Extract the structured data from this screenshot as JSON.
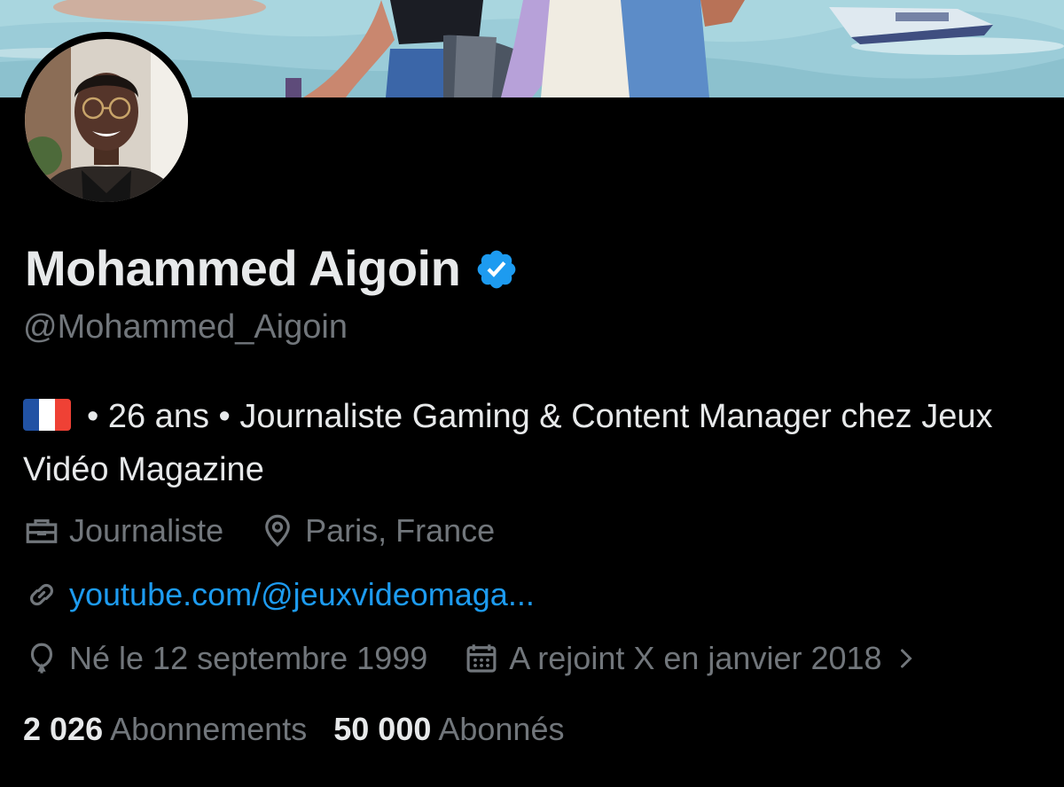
{
  "profile": {
    "display_name": "Mohammed Aigoin",
    "handle": "@Mohammed_Aigoin",
    "verified": true,
    "bio": {
      "flag_icon": "flag-france-icon",
      "text": "• 26 ans • Journaliste Gaming & Content Manager chez Jeux Vidéo Magazine"
    },
    "profession": "Journaliste",
    "location": "Paris, France",
    "website": "youtube.com/@jeuxvideomaga...",
    "birthday": "Né le 12 septembre 1999",
    "joined": "A rejoint X en janvier 2018",
    "following_count": "2 026",
    "following_label": "Abonnements",
    "followers_count": "50 000",
    "followers_label": "Abonnés"
  },
  "icons": {
    "verified": "verified-badge-icon",
    "profession": "briefcase-icon",
    "location": "location-pin-icon",
    "website": "link-icon",
    "birthday": "balloon-icon",
    "joined": "calendar-icon",
    "more": "chevron-right-icon"
  },
  "colors": {
    "background": "#000000",
    "primary_text": "#e7e9ea",
    "secondary_text": "#71767b",
    "link": "#1d9bf0",
    "verified_badge": "#1d9bf0"
  }
}
